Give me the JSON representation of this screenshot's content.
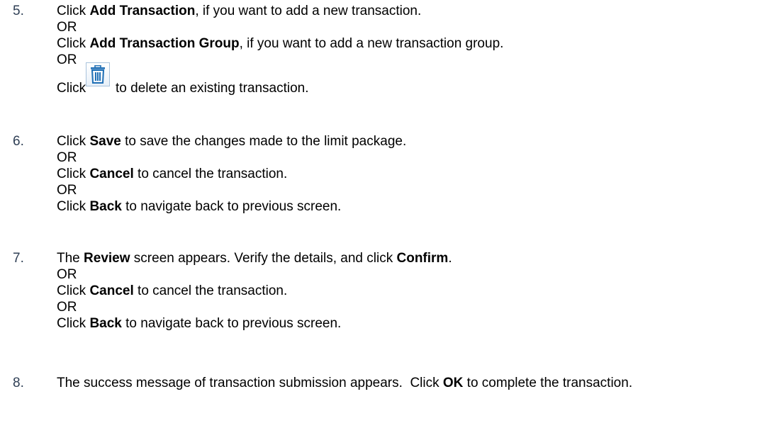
{
  "steps": [
    {
      "num": "5.",
      "lines": [
        {
          "a": "Click ",
          "b": "Add Transaction",
          "c": ", if you want to add a new transaction."
        },
        {
          "text": "OR"
        },
        {
          "a": "Click ",
          "b": "Add Transaction Group",
          "c": ", if you want to add a new transaction group."
        },
        {
          "text": "OR"
        }
      ],
      "icon_line": {
        "pre": "Click",
        "icon": "trash-icon",
        "post": "to delete an existing transaction."
      }
    },
    {
      "num": "6.",
      "lines": [
        {
          "a": "Click ",
          "b": "Save",
          "c": " to save the changes made to the limit package."
        },
        {
          "text": "OR"
        },
        {
          "a": "Click ",
          "b": "Cancel",
          "c": " to cancel the transaction."
        },
        {
          "text": "OR"
        },
        {
          "a": "Click ",
          "b": "Back",
          "c": " to navigate back to previous screen."
        }
      ]
    },
    {
      "num": "7.",
      "lines": [
        {
          "a": "The ",
          "b": "Review",
          "c": " screen appears. Verify the details, and click ",
          "d": "Confirm",
          "e": "."
        },
        {
          "text": "OR"
        },
        {
          "a": "Click ",
          "b": "Cancel",
          "c": " to cancel the transaction."
        },
        {
          "text": "OR"
        },
        {
          "a": "Click ",
          "b": "Back",
          "c": " to navigate back to previous screen."
        }
      ]
    },
    {
      "num": "8.",
      "lines": [
        {
          "a": "The success message of transaction submission appears.  Click ",
          "b": "OK",
          "c": " to complete the transaction."
        }
      ]
    }
  ],
  "colors": {
    "step_number": "#2f3f55",
    "icon_blue": "#1f6fb5",
    "icon_border": "#a9c3dc"
  }
}
